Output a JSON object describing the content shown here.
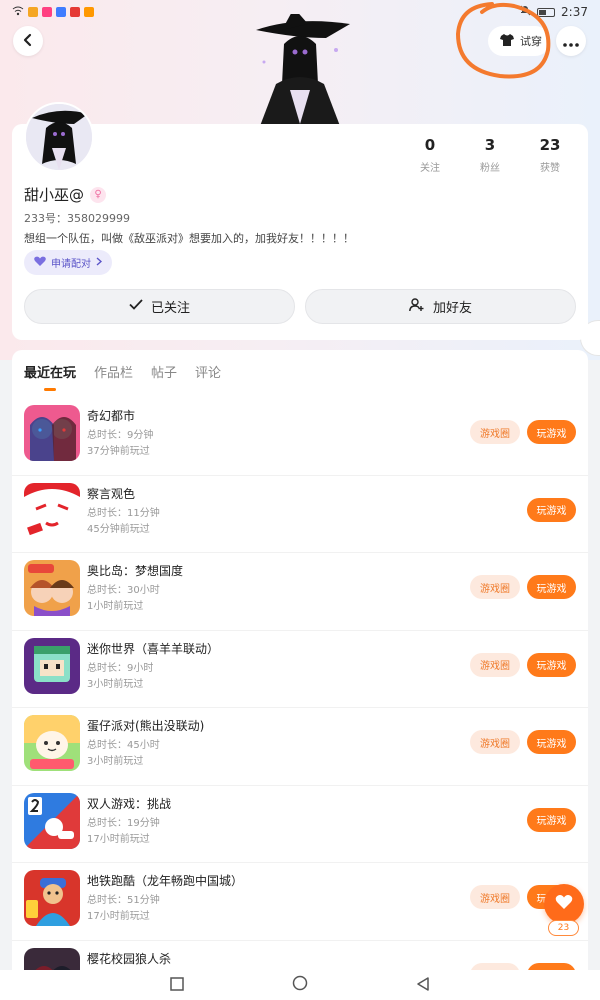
{
  "status_bar": {
    "time": "2:37"
  },
  "header": {
    "try_label": "试穿"
  },
  "profile": {
    "stats": [
      {
        "value": "0",
        "label": "关注"
      },
      {
        "value": "3",
        "label": "粉丝"
      },
      {
        "value": "23",
        "label": "获赞"
      }
    ],
    "username": "甜小巫@",
    "gender_symbol": "♀",
    "uid": "233号：358029999",
    "bio": "想组一个队伍，叫做《敌巫派对》想要加入的，加我好友！！！！！",
    "pair_label": "申请配对",
    "follow_label": "已关注",
    "add_friend_label": "加好友"
  },
  "tabs": [
    "最近在玩",
    "作品栏",
    "帖子",
    "评论"
  ],
  "games": [
    {
      "title": "奇幻都市",
      "duration": "总时长：9分钟",
      "last_played": "37分钟前玩过",
      "circle_label": "游戏圈",
      "play_label": "玩游戏",
      "icon": "anime-duo-icon"
    },
    {
      "title": "察言观色",
      "duration": "总时长：11分钟",
      "last_played": "45分钟前玩过",
      "circle_label": "",
      "play_label": "玩游戏",
      "icon": "white-face-icon"
    },
    {
      "title": "奥比岛：梦想国度",
      "duration": "总时长：30小时",
      "last_played": "1小时前玩过",
      "circle_label": "游戏圈",
      "play_label": "玩游戏",
      "icon": "obi-island-icon"
    },
    {
      "title": "迷你世界（喜羊羊联动）",
      "duration": "总时长：9小时",
      "last_played": "3小时前玩过",
      "circle_label": "游戏圈",
      "play_label": "玩游戏",
      "icon": "mini-world-icon"
    },
    {
      "title": "蛋仔派对(熊出没联动)",
      "duration": "总时长：45小时",
      "last_played": "3小时前玩过",
      "circle_label": "游戏圈",
      "play_label": "玩游戏",
      "icon": "eggy-party-icon"
    },
    {
      "title": "双人游戏：挑战",
      "duration": "总时长：19分钟",
      "last_played": "17小时前玩过",
      "circle_label": "",
      "play_label": "玩游戏",
      "icon": "two-player-icon"
    },
    {
      "title": "地铁跑酷（龙年畅跑中国城）",
      "duration": "总时长：51分钟",
      "last_played": "17小时前玩过",
      "circle_label": "游戏圈",
      "play_label": "玩游戏",
      "icon": "subway-surfers-icon"
    },
    {
      "title": "樱花校园狼人杀",
      "duration": "",
      "last_played": "",
      "circle_label": "游戏圈",
      "play_label": "玩游戏",
      "icon": "sakura-school-icon"
    }
  ],
  "likes": {
    "count": "23"
  },
  "colors": {
    "accent": "#ff7a1a",
    "chip_bg": "#fde9de",
    "pair_bg": "#ecebfb"
  }
}
